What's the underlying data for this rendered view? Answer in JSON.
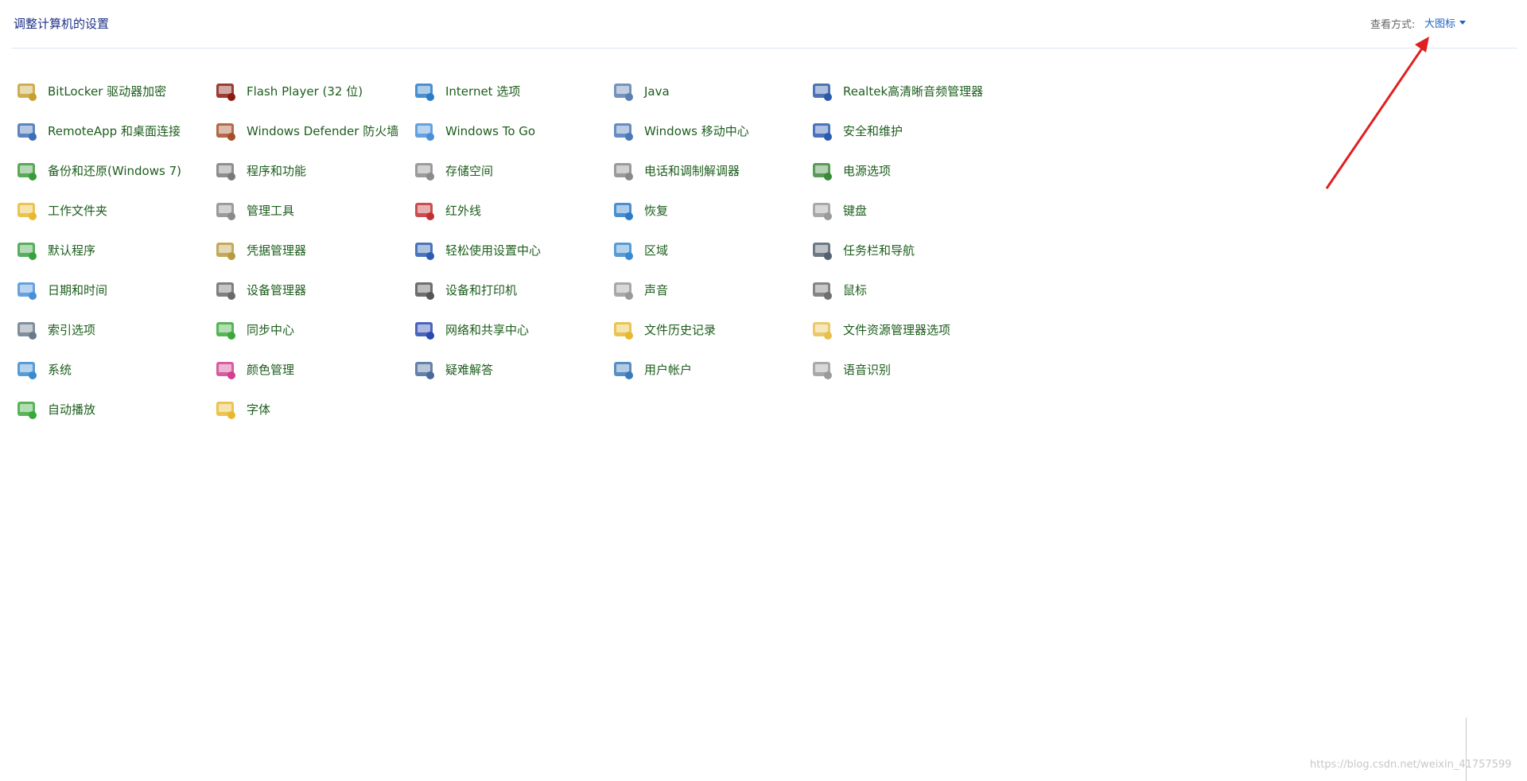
{
  "header": {
    "title": "调整计算机的设置",
    "view_label": "查看方式:",
    "view_mode": "大图标"
  },
  "items": [
    {
      "label": "BitLocker 驱动器加密",
      "icon": "bitlocker-icon",
      "color": "#c7a030"
    },
    {
      "label": "Flash Player (32 位)",
      "icon": "flash-player-icon",
      "color": "#8b1a10"
    },
    {
      "label": "Internet 选项",
      "icon": "internet-options-icon",
      "color": "#2a7bc8"
    },
    {
      "label": "Java",
      "icon": "java-icon",
      "color": "#5b7fb0"
    },
    {
      "label": "Realtek高清晰音频管理器",
      "icon": "realtek-audio-icon",
      "color": "#2b5aa8"
    },
    {
      "label": "RemoteApp 和桌面连接",
      "icon": "remoteapp-icon",
      "color": "#3e6eb5"
    },
    {
      "label": "Windows Defender 防火墙",
      "icon": "firewall-icon",
      "color": "#a5502a"
    },
    {
      "label": "Windows To Go",
      "icon": "windows-to-go-icon",
      "color": "#4a90d9"
    },
    {
      "label": "Windows 移动中心",
      "icon": "mobility-center-icon",
      "color": "#4b78b8"
    },
    {
      "label": "安全和维护",
      "icon": "security-flag-icon",
      "color": "#2c5bb0"
    },
    {
      "label": "备份和还原(Windows 7)",
      "icon": "backup-icon",
      "color": "#3d9a3a"
    },
    {
      "label": "程序和功能",
      "icon": "programs-icon",
      "color": "#7a7a7a"
    },
    {
      "label": "存储空间",
      "icon": "storage-spaces-icon",
      "color": "#8a8a8a"
    },
    {
      "label": "电话和调制解调器",
      "icon": "phone-modem-icon",
      "color": "#888888"
    },
    {
      "label": "电源选项",
      "icon": "power-options-icon",
      "color": "#3a8a3a"
    },
    {
      "label": "工作文件夹",
      "icon": "work-folders-icon",
      "color": "#e8b830"
    },
    {
      "label": "管理工具",
      "icon": "admin-tools-icon",
      "color": "#8a8a8a"
    },
    {
      "label": "红外线",
      "icon": "infrared-icon",
      "color": "#c03030"
    },
    {
      "label": "恢复",
      "icon": "recovery-icon",
      "color": "#2a7bc8"
    },
    {
      "label": "键盘",
      "icon": "keyboard-icon",
      "color": "#9a9a9a"
    },
    {
      "label": "默认程序",
      "icon": "default-programs-icon",
      "color": "#3aa040"
    },
    {
      "label": "凭据管理器",
      "icon": "credential-manager-icon",
      "color": "#b89a40"
    },
    {
      "label": "轻松使用设置中心",
      "icon": "ease-of-access-icon",
      "color": "#2a5db0"
    },
    {
      "label": "区域",
      "icon": "region-icon",
      "color": "#3a8ad0"
    },
    {
      "label": "任务栏和导航",
      "icon": "taskbar-icon",
      "color": "#556070"
    },
    {
      "label": "日期和时间",
      "icon": "date-time-icon",
      "color": "#4a90d9"
    },
    {
      "label": "设备管理器",
      "icon": "device-manager-icon",
      "color": "#6a6a6a"
    },
    {
      "label": "设备和打印机",
      "icon": "devices-printers-icon",
      "color": "#555555"
    },
    {
      "label": "声音",
      "icon": "sound-icon",
      "color": "#999999"
    },
    {
      "label": "鼠标",
      "icon": "mouse-icon",
      "color": "#707070"
    },
    {
      "label": "索引选项",
      "icon": "indexing-icon",
      "color": "#6a7a8a"
    },
    {
      "label": "同步中心",
      "icon": "sync-center-icon",
      "color": "#3aa83a"
    },
    {
      "label": "网络和共享中心",
      "icon": "network-sharing-icon",
      "color": "#2a4ab0"
    },
    {
      "label": "文件历史记录",
      "icon": "file-history-icon",
      "color": "#e8b830"
    },
    {
      "label": "文件资源管理器选项",
      "icon": "explorer-options-icon",
      "color": "#e8c050"
    },
    {
      "label": "系统",
      "icon": "system-icon",
      "color": "#3a8ad0"
    },
    {
      "label": "颜色管理",
      "icon": "color-management-icon",
      "color": "#d04090"
    },
    {
      "label": "疑难解答",
      "icon": "troubleshooting-icon",
      "color": "#4a6a9a"
    },
    {
      "label": "用户帐户",
      "icon": "user-accounts-icon",
      "color": "#3a7ab8"
    },
    {
      "label": "语音识别",
      "icon": "speech-recognition-icon",
      "color": "#9a9a9a"
    },
    {
      "label": "自动播放",
      "icon": "autoplay-icon",
      "color": "#3aa83a"
    },
    {
      "label": "字体",
      "icon": "fonts-icon",
      "color": "#e8b830"
    }
  ],
  "watermark": "https://blog.csdn.net/weixin_41757599"
}
